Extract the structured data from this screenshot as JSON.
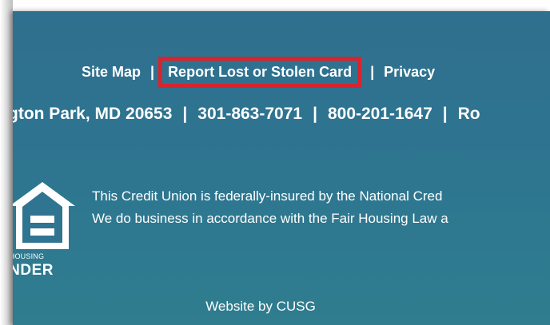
{
  "footer": {
    "links": {
      "site_map": "Site Map",
      "report_lost": "Report Lost or Stolen Card",
      "privacy": "Privacy",
      "separator": "|"
    },
    "info": {
      "address": "gton Park, MD 20653",
      "phone_local": "301-863-7071",
      "phone_toll_free": "800-201-1647",
      "cut_text": "Ro",
      "separator": "|"
    },
    "equal_housing": {
      "line1": "AL HOUSING",
      "line2": "ENDER"
    },
    "disclaimer": {
      "line1": "This Credit Union is federally-insured by the National Cred",
      "line2": "We do business in accordance with the Fair Housing Law a"
    },
    "credit": {
      "text": "Website by CUSG"
    },
    "colors": {
      "background": "#2f7490",
      "highlight_border": "#d9232d",
      "text": "#ffffff"
    }
  }
}
